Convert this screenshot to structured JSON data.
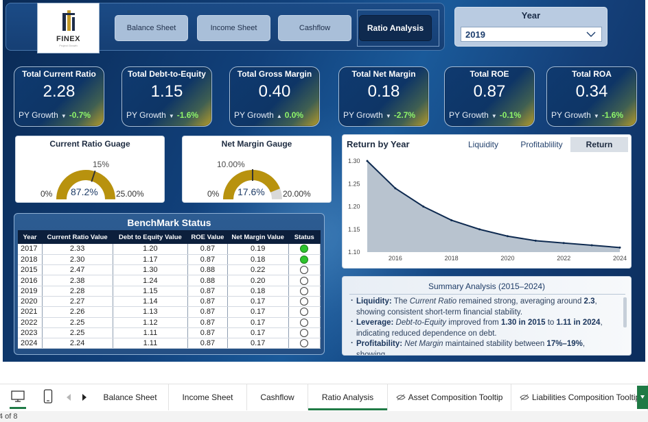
{
  "logo": {
    "brand": "FINEX",
    "tagline": "Project Growth"
  },
  "nav": {
    "buttons": [
      "Balance Sheet",
      "Income Sheet",
      "Cashflow",
      "Ratio Analysis"
    ],
    "active": "Ratio Analysis"
  },
  "year_slicer": {
    "title": "Year",
    "value": "2019"
  },
  "kpis": [
    {
      "title": "Total Current Ratio",
      "value": "2.28",
      "growth_label": "PY Growth",
      "growth": "-0.7%",
      "direction": "down"
    },
    {
      "title": "Total Debt-to-Equity",
      "value": "1.15",
      "growth_label": "PY Growth",
      "growth": "-1.6%",
      "direction": "down"
    },
    {
      "title": "Total Gross Margin",
      "value": "0.40",
      "growth_label": "PY Growth",
      "growth": "0.0%",
      "direction": "up"
    },
    {
      "title": "Total Net Margin",
      "value": "0.18",
      "growth_label": "PY Growth",
      "growth": "-2.7%",
      "direction": "down"
    },
    {
      "title": "Total ROE",
      "value": "0.87",
      "growth_label": "PY Growth",
      "growth": "-0.1%",
      "direction": "down"
    },
    {
      "title": "Total ROA",
      "value": "0.34",
      "growth_label": "PY Growth",
      "growth": "-1.6%",
      "direction": "down"
    }
  ],
  "gauges": [
    {
      "title": "Current Ratio Guage",
      "min_label": "0%",
      "max_label": "25.00%",
      "target_label": "15%",
      "value_label": "87.2%",
      "fill": 1.0,
      "target": 0.6
    },
    {
      "title": "Net Margin Gauge",
      "min_label": "0%",
      "max_label": "20.00%",
      "target_label": "10.00%",
      "value_label": "17.6%",
      "fill": 0.88,
      "target": 0.5
    }
  ],
  "line_chart": {
    "title": "Return by Year",
    "tabs": [
      "Liquidity",
      "Profitablility",
      "Return"
    ],
    "active_tab": "Return"
  },
  "chart_data": {
    "type": "area",
    "title": "Return by Year",
    "x": [
      2015,
      2016,
      2017,
      2018,
      2019,
      2020,
      2021,
      2022,
      2023,
      2024
    ],
    "values": [
      1.3,
      1.24,
      1.2,
      1.17,
      1.15,
      1.135,
      1.125,
      1.12,
      1.115,
      1.11
    ],
    "xticks": [
      "2016",
      "2018",
      "2020",
      "2022",
      "2024"
    ],
    "yticks": [
      "1.30",
      "1.25",
      "1.20",
      "1.15",
      "1.10"
    ],
    "ylim": [
      1.1,
      1.3
    ],
    "xlim": [
      2015,
      2024
    ],
    "colors": {
      "line": "#0e2a50",
      "fill": "#b8c3cf"
    }
  },
  "summary": {
    "title": "Summary Analysis (2015–2024)",
    "items": [
      {
        "label": "Liquidity:",
        "text_a": " The ",
        "em": "Current Ratio",
        "text_b": " remained strong, averaging around ",
        "strong": "2.3",
        "text_c": ", showing consistent short-term financial stability."
      },
      {
        "label": "Leverage:",
        "text_a": " ",
        "em": "Debt-to-Equity",
        "text_b": " improved from ",
        "strong": "1.30 in 2015",
        "text_c": " to ",
        "strong2": "1.11 in 2024",
        "text_d": ", indicating reduced dependence on debt."
      },
      {
        "label": "Profitability:",
        "text_a": " ",
        "em": "Net Margin",
        "text_b": " maintained stability between ",
        "strong": "17%–19%",
        "text_c": ", showing"
      }
    ]
  },
  "benchmark": {
    "title": "BenchMark Status",
    "columns": [
      "Year",
      "Current Ratio Value",
      "Debt to Equity Value",
      "ROE Value",
      "Net Margin Value",
      "Status"
    ],
    "rows": [
      [
        "2017",
        "2.33",
        "1.20",
        "0.87",
        "0.19",
        true
      ],
      [
        "2018",
        "2.30",
        "1.17",
        "0.87",
        "0.18",
        true
      ],
      [
        "2015",
        "2.47",
        "1.30",
        "0.88",
        "0.22",
        false
      ],
      [
        "2016",
        "2.38",
        "1.24",
        "0.88",
        "0.20",
        false
      ],
      [
        "2019",
        "2.28",
        "1.15",
        "0.87",
        "0.18",
        false
      ],
      [
        "2020",
        "2.27",
        "1.14",
        "0.87",
        "0.17",
        false
      ],
      [
        "2021",
        "2.26",
        "1.13",
        "0.87",
        "0.17",
        false
      ],
      [
        "2022",
        "2.25",
        "1.12",
        "0.87",
        "0.17",
        false
      ],
      [
        "2023",
        "2.25",
        "1.11",
        "0.87",
        "0.17",
        false
      ],
      [
        "2024",
        "2.24",
        "1.11",
        "0.87",
        "0.17",
        false
      ]
    ]
  },
  "page_tabs": {
    "items": [
      "Balance Sheet",
      "Income Sheet",
      "Cashflow",
      "Ratio Analysis",
      "Asset Composition Tooltip",
      "Liabilities Composition Tooltip"
    ],
    "active": "Ratio Analysis",
    "status": "4 of 8"
  }
}
